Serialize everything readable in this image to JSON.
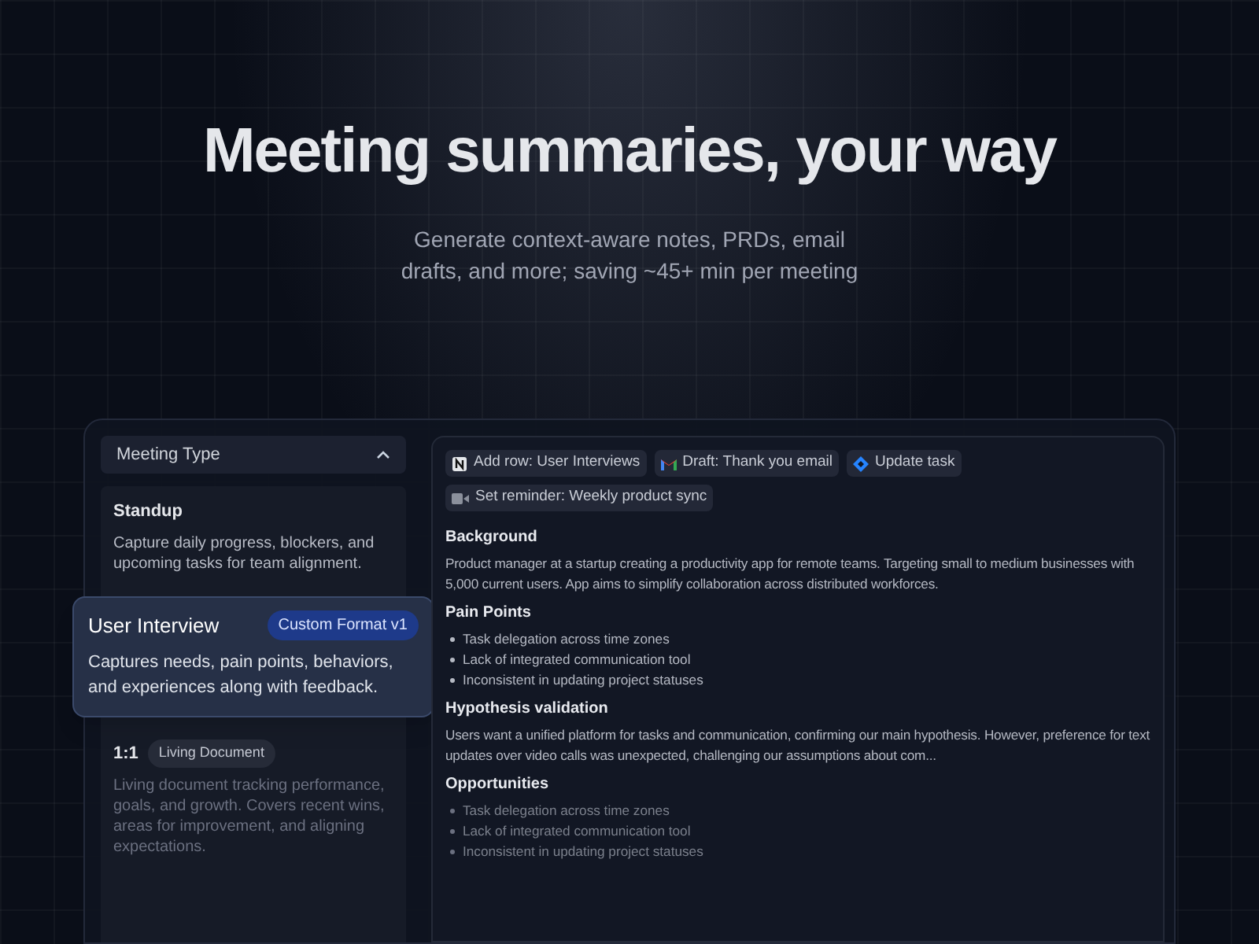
{
  "hero": {
    "title": "Meeting summaries, your way",
    "subtitle": "Generate context-aware notes, PRDs, email drafts, and more; saving ~45+ min per meeting"
  },
  "meeting_type": {
    "label": "Meeting Type",
    "expanded": true,
    "items": [
      {
        "title": "Standup",
        "description": "Capture daily progress, blockers, and upcoming tasks for team alignment.",
        "selected": false
      },
      {
        "title": "User Interview",
        "badge": "Custom Format v1",
        "description": "Captures needs, pain points, behaviors, and experiences along with feedback.",
        "selected": true
      },
      {
        "title": "1:1",
        "badge": "Living Document",
        "description": "Living document tracking performance, goals, and growth. Covers recent wins, areas for improvement, and aligning expectations.",
        "selected": false
      }
    ]
  },
  "actions": [
    {
      "kind": "notion",
      "label": "Add row: User Interviews"
    },
    {
      "kind": "gmail",
      "label": "Draft: Thank you email"
    },
    {
      "kind": "jira",
      "label": "Update task"
    },
    {
      "kind": "video",
      "label": "Set reminder: Weekly product sync"
    }
  ],
  "sections": [
    {
      "heading": "Background",
      "text": "Product manager at a startup creating a productivity app for remote teams. Targeting small to medium businesses with 5,000 current users. App aims to simplify collaboration across distributed workforces."
    },
    {
      "heading": "Pain Points",
      "bullets": [
        "Task delegation across time zones",
        "Lack of integrated communication tool",
        "Inconsistent in updating project statuses"
      ]
    },
    {
      "heading": "Hypothesis validation",
      "text": "Users want a unified platform for tasks and communication, confirming our main hypothesis. However, preference for text updates over video calls was unexpected, challenging our assumptions about com..."
    },
    {
      "heading": "Opportunities",
      "bullets": [
        "Task delegation across time zones",
        "Lack of integrated communication tool",
        "Inconsistent in updating project statuses"
      ]
    }
  ]
}
